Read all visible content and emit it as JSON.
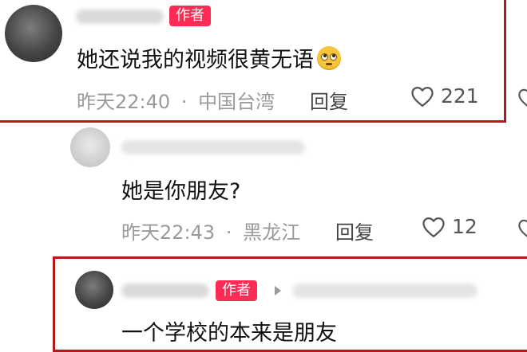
{
  "comments": [
    {
      "text": "她还说我的视频很黄无语",
      "author_tag": "作者",
      "emoji": "face-with-rolling-eyes-icon",
      "time": "昨天22:40",
      "separator": "·",
      "location": "中国台湾",
      "reply_label": "回复",
      "likes": "221"
    },
    {
      "text": "她是你朋友?",
      "time": "昨天22:43",
      "separator": "·",
      "location": "黑龙江",
      "reply_label": "回复",
      "likes": "12"
    },
    {
      "text": "一个学校的本来是朋友",
      "author_tag": "作者"
    }
  ],
  "colors": {
    "author_tag_bg": "#fe2c55",
    "highlight_border": "#b31b1b",
    "meta_gray": "#9a9a9a"
  }
}
